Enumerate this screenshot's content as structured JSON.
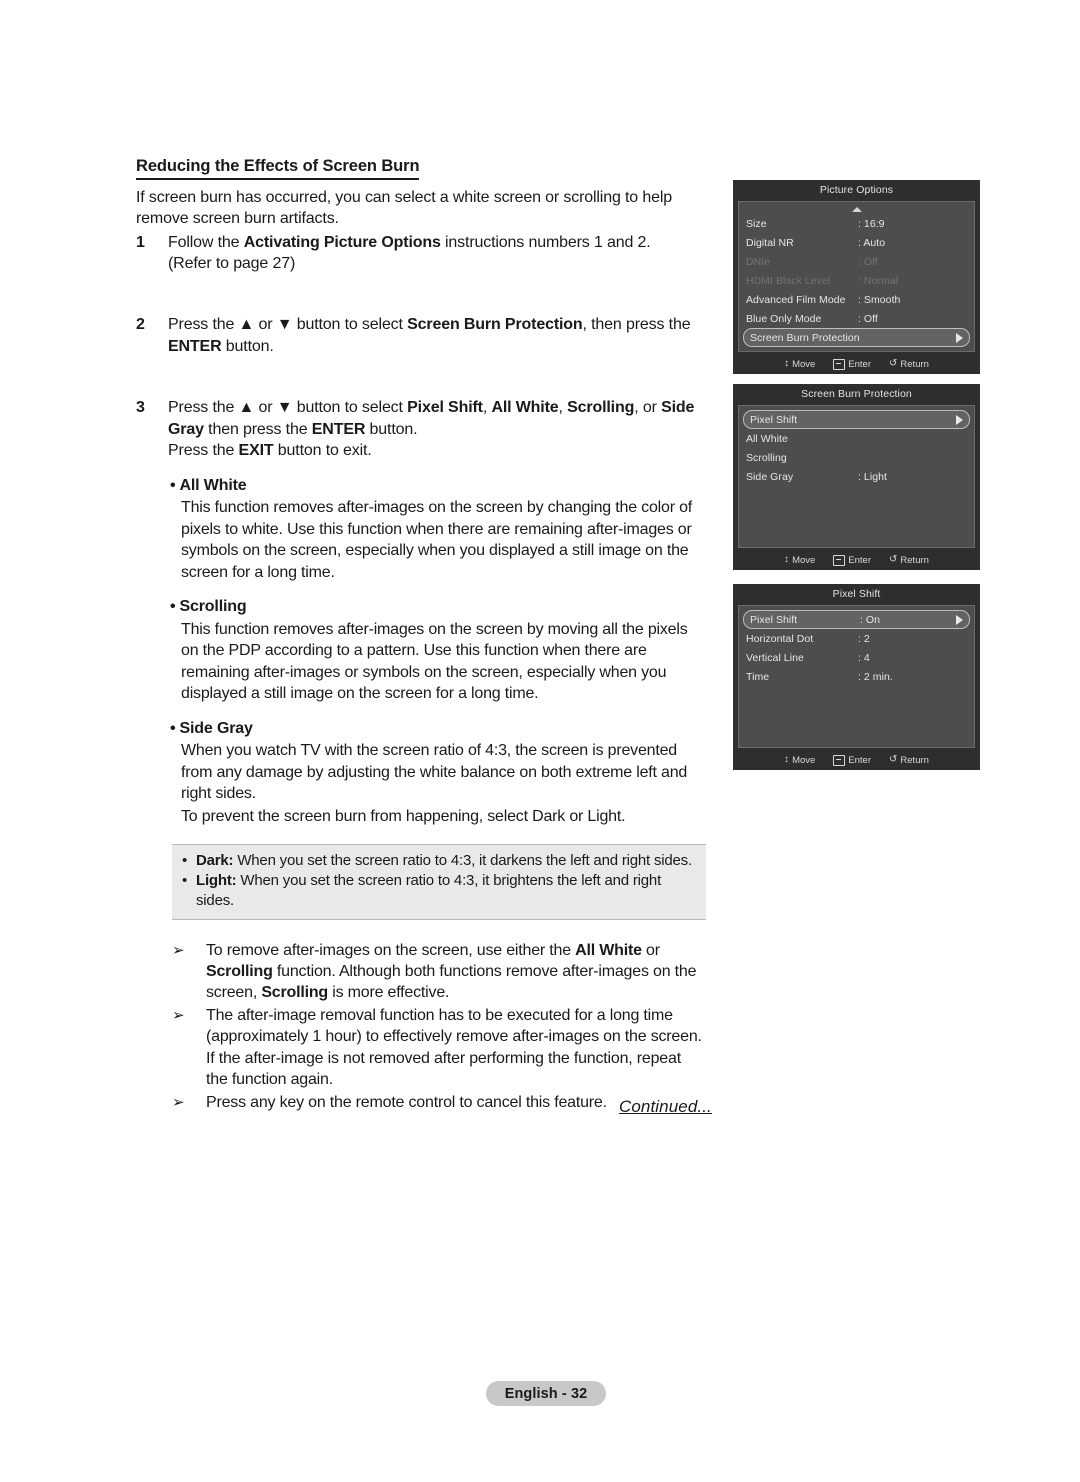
{
  "document": {
    "section_heading": "Reducing the Effects of Screen Burn",
    "intro": "If screen burn has occurred, you can select a white screen or scrolling to help remove screen burn artifacts.",
    "continued_label": "Continued...",
    "page_badge": "English - 32"
  },
  "steps": [
    {
      "num": "1",
      "text_prefix": "Follow the ",
      "bold1": "Activating Picture Options",
      "text_mid": " instructions numbers 1 and 2.",
      "line2": "(Refer to page 27)"
    },
    {
      "num": "2",
      "line1": "Press the ▲ or ▼ button to select ",
      "bold1": "Screen Burn Protection",
      "line1b": ", then press the ",
      "bold2": "ENTER",
      "line1c": " button."
    },
    {
      "num": "3",
      "line1": "Press the ▲ or ▼ button to select ",
      "b1": "Pixel Shift",
      "sep1": ", ",
      "b2": "All White",
      "sep2": ", ",
      "b3": "Scrolling",
      "sep3": ", or ",
      "b4": "Side Gray",
      "sep4": " then press the ",
      "b5": "ENTER",
      "sep5": " button.",
      "line2a": "Press the ",
      "b6": "EXIT",
      "line2b": " button to exit."
    }
  ],
  "subsections": [
    {
      "title": "All White",
      "body": "This function removes after-images on the screen by changing the color of pixels to white. Use this function when there are remaining after-images or symbols on the screen, especially when you displayed a still image on the screen for a long time."
    },
    {
      "title": "Scrolling",
      "body": "This function removes after-images on the screen by moving all the pixels on the PDP according to a pattern. Use this function when there are remaining after-images or symbols on the screen, especially when you displayed a still image on the screen for a long time."
    },
    {
      "title": "Side Gray",
      "body": "When you watch TV with the screen ratio of 4:3, the screen is prevented from any damage by adjusting the white balance on both extreme left and right sides.",
      "body2": "To prevent the screen burn from happening, select Dark or Light."
    }
  ],
  "note_box": {
    "bullet": "•",
    "lines": [
      {
        "bold": "Dark:",
        "text": " When you set the screen ratio to 4:3, it darkens the left and right sides."
      },
      {
        "bold": "Light:",
        "text": " When you set the screen ratio to 4:3, it brightens the left and right sides."
      }
    ]
  },
  "arrow_notes": {
    "glyph": "➢",
    "items": [
      {
        "a": "To remove after-images on the screen, use either the ",
        "b1": "All White",
        "c": " or ",
        "b2": "Scrolling",
        "d": " function. Although both functions remove after-images on the screen, ",
        "b3": "Scrolling",
        "e": " is more effective."
      },
      {
        "a": "The after-image removal function has to be executed for a long time (approximately 1 hour) to effectively remove after-images on the screen. If the after-image is not removed after performing the function, repeat the function again."
      },
      {
        "a": "Press any key on the remote control to cancel this feature."
      }
    ]
  },
  "osd_footer": {
    "move_glyph": "↕",
    "move_label": "Move",
    "enter_label": "Enter",
    "return_glyph": "↺",
    "return_label": "Return"
  },
  "osd_panels": [
    {
      "title": "Picture Options",
      "has_scroll_up": true,
      "rows": [
        {
          "label": "Size",
          "value": ": 16:9",
          "state": "normal"
        },
        {
          "label": "Digital NR",
          "value": ": Auto",
          "state": "normal"
        },
        {
          "label": "DNIe",
          "value": ": Off",
          "state": "dim"
        },
        {
          "label": "HDMI Black Level",
          "value": ": Normal",
          "state": "dim"
        },
        {
          "label": "Advanced Film Mode",
          "value": ": Smooth",
          "state": "normal"
        },
        {
          "label": "Blue Only Mode",
          "value": ": Off",
          "state": "normal"
        },
        {
          "label": "Screen Burn Protection",
          "value": "",
          "state": "highlight",
          "arrow": true
        }
      ],
      "blank_rows": 0
    },
    {
      "title": "Screen Burn Protection",
      "has_scroll_up": false,
      "rows": [
        {
          "label": "Pixel Shift",
          "value": "",
          "state": "highlight",
          "arrow": true
        },
        {
          "label": "All White",
          "value": "",
          "state": "normal"
        },
        {
          "label": "Scrolling",
          "value": "",
          "state": "normal"
        },
        {
          "label": "Side Gray",
          "value": ": Light",
          "state": "normal"
        }
      ],
      "blank_rows": 3
    },
    {
      "title": "Pixel Shift",
      "has_scroll_up": false,
      "rows": [
        {
          "label": "Pixel Shift",
          "value": ": On",
          "state": "highlight",
          "arrow": true
        },
        {
          "label": "Horizontal Dot",
          "value": ": 2",
          "state": "normal"
        },
        {
          "label": "Vertical Line",
          "value": ": 4",
          "state": "normal"
        },
        {
          "label": "Time",
          "value": ": 2 min.",
          "state": "normal"
        }
      ],
      "blank_rows": 3
    }
  ]
}
